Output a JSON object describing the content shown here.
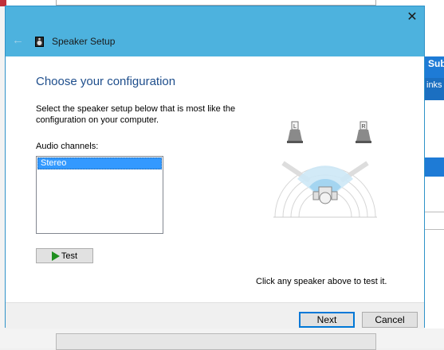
{
  "dialog": {
    "title": "Speaker Setup",
    "heading": "Choose your configuration",
    "description": "Select the speaker setup below that is most like the configuration on your computer.",
    "audio_channels_label": "Audio channels:",
    "channels": [
      "Stereo"
    ],
    "selected_channel": "Stereo",
    "test_label": "Test",
    "hint": "Click any speaker above to test it.",
    "next_label": "Next",
    "cancel_label": "Cancel",
    "close_glyph": "✕",
    "back_glyph": "←"
  },
  "speakers": {
    "left_label": "L",
    "right_label": "R"
  },
  "background": {
    "right_title": "Sub",
    "right_subtitle": "inks"
  },
  "colors": {
    "titlebar": "#4db2de",
    "heading": "#1e4e8c",
    "selection": "#3399ff",
    "default_button_border": "#0078d7"
  },
  "icons": [
    "close-icon",
    "back-arrow-icon",
    "speaker-app-icon",
    "play-icon",
    "left-speaker-icon",
    "right-speaker-icon",
    "listener-icon"
  ]
}
